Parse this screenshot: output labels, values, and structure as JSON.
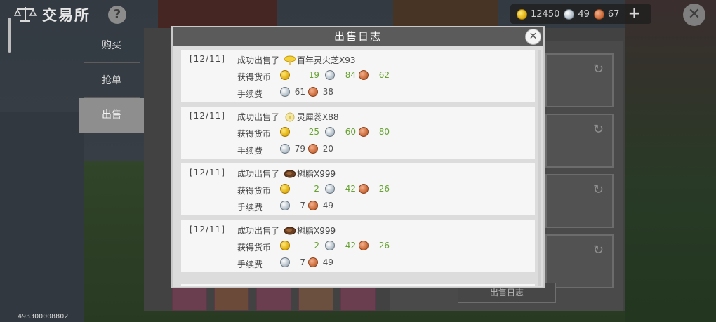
{
  "header": {
    "title": "交易所",
    "help_label": "?",
    "currency": {
      "gold": "12450",
      "silver": "49",
      "copper": "67"
    },
    "add_label": "+",
    "close_label": "✕"
  },
  "menu": {
    "items": [
      {
        "label": "购买",
        "active": false
      },
      {
        "label": "抢单",
        "active": false
      },
      {
        "label": "出售",
        "active": true
      }
    ]
  },
  "background": {
    "sale_log_button": "出售日志",
    "user_id": "493300008802"
  },
  "modal": {
    "title": "出售日志",
    "close_label": "✕",
    "income_label": "获得货币",
    "fee_label": "手续费",
    "entries": [
      {
        "date": "[12/11]",
        "action": "成功出售了",
        "item_name": "百年灵火芝",
        "quantity": "X93",
        "income": {
          "gold": "19",
          "silver": "84",
          "copper": "62"
        },
        "fee": {
          "silver": "61",
          "copper": "38"
        },
        "item_icon": "mushroom-icon"
      },
      {
        "date": "[12/11]",
        "action": "成功出售了",
        "item_name": "灵犀蕊",
        "quantity": "X88",
        "income": {
          "gold": "25",
          "silver": "60",
          "copper": "80"
        },
        "fee": {
          "silver": "79",
          "copper": "20"
        },
        "item_icon": "flower-icon"
      },
      {
        "date": "[12/11]",
        "action": "成功出售了",
        "item_name": "树脂",
        "quantity": "X999",
        "income": {
          "gold": "2",
          "silver": "42",
          "copper": "26"
        },
        "fee": {
          "silver": "7",
          "copper": "49"
        },
        "item_icon": "resin-icon"
      },
      {
        "date": "[12/11]",
        "action": "成功出售了",
        "item_name": "树脂",
        "quantity": "X999",
        "income": {
          "gold": "2",
          "silver": "42",
          "copper": "26"
        },
        "fee": {
          "silver": "7",
          "copper": "49"
        },
        "item_icon": "resin-icon"
      }
    ]
  },
  "colors": {
    "income_value": "#67a231",
    "modal_header": "#5b5b5b",
    "menu_active": "#8e8e8e"
  }
}
